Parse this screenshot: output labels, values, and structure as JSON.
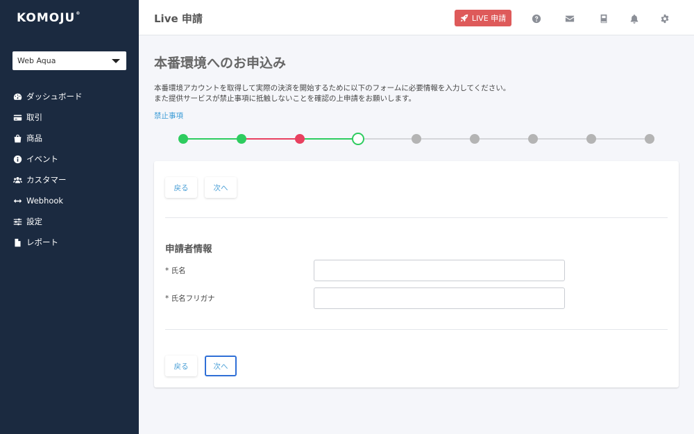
{
  "brand": {
    "logo": "KOMOJU",
    "mark": "®"
  },
  "sidebar": {
    "account_select": "Web Aqua",
    "items": [
      {
        "label": "ダッシュボード",
        "icon": "dashboard-icon"
      },
      {
        "label": "取引",
        "icon": "credit-card-icon"
      },
      {
        "label": "商品",
        "icon": "shopping-bag-icon"
      },
      {
        "label": "イベント",
        "icon": "info-icon"
      },
      {
        "label": "カスタマー",
        "icon": "users-icon"
      },
      {
        "label": "Webhook",
        "icon": "arrows-h-icon"
      },
      {
        "label": "設定",
        "icon": "sliders-icon"
      },
      {
        "label": "レポート",
        "icon": "file-icon"
      }
    ]
  },
  "header": {
    "title": "Live 申請",
    "live_button": "LIVE 申請",
    "icons": [
      "help-icon",
      "mail-icon",
      "book-icon",
      "bell-icon",
      "gear-icon"
    ]
  },
  "main": {
    "title": "本番環境へのお申込み",
    "description_line1": "本番環境アカウントを取得して実際の決済を開始するために以下のフォームに必要情報を入力してください。",
    "description_line2": "また提供サービスが禁止事項に抵触しないことを確認の上申請をお願いします。",
    "link": "禁止事項",
    "stepper": {
      "total_steps": 9,
      "current_step": 4,
      "step_colors": [
        "#2ecc5f",
        "#2ecc5f",
        "#e8405f",
        "#2ecc5f",
        "#b4b4b4",
        "#b4b4b4",
        "#b4b4b4",
        "#b4b4b4",
        "#b4b4b4"
      ],
      "line_colors": [
        "#2ecc5f",
        "#e8405f",
        "#2ecc5f",
        "#d5d6da",
        "#d5d6da",
        "#d5d6da",
        "#d5d6da",
        "#d5d6da"
      ]
    },
    "form": {
      "back_label": "戻る",
      "next_label": "次へ",
      "section_title": "申請者情報",
      "fields": [
        {
          "label": "* 氏名",
          "value": ""
        },
        {
          "label": "* 氏名フリガナ",
          "value": ""
        }
      ]
    }
  }
}
